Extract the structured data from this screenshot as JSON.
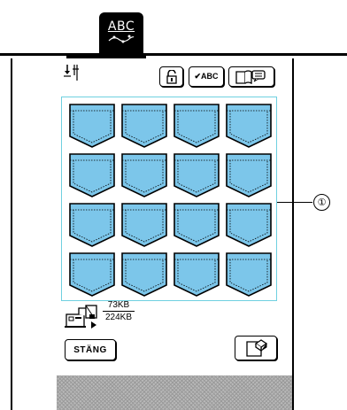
{
  "header": {
    "tab_label": "ABC",
    "tab_icon": "ornament-icon"
  },
  "toolbar": {
    "needle_icon": "needle-position-icon",
    "lock_icon": "unlock-icon",
    "check_label": "✔ABC",
    "book_icon": "open-book-icon"
  },
  "grid": {
    "rows": 4,
    "columns": 4,
    "pattern_name": "pocket",
    "pattern_color": "#7cc6ea",
    "border_color": "#6fd0e0"
  },
  "annotation": {
    "marker": "①"
  },
  "memory": {
    "icon": "machine-memory-icon",
    "used": "73KB",
    "total": "224KB"
  },
  "footer": {
    "close_label": "STÄNG",
    "save_icon": "save-to-machine-icon"
  }
}
